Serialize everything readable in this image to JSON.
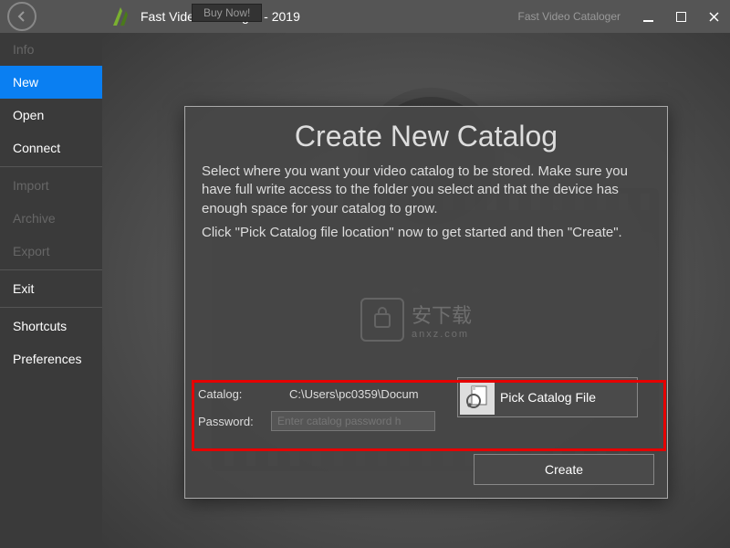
{
  "titlebar": {
    "app_title": "Fast Video Cataloger - 2019",
    "buy_now": "Buy Now!",
    "right_text": "Fast Video Cataloger"
  },
  "sidebar": {
    "items": [
      {
        "label": "Info",
        "active": false,
        "disabled": true
      },
      {
        "label": "New",
        "active": true,
        "disabled": false
      },
      {
        "label": "Open",
        "active": false,
        "disabled": false
      },
      {
        "label": "Connect",
        "active": false,
        "disabled": false
      }
    ],
    "items2": [
      {
        "label": "Import",
        "disabled": true
      },
      {
        "label": "Archive",
        "disabled": true
      },
      {
        "label": "Export",
        "disabled": true
      }
    ],
    "items3": [
      {
        "label": "Exit"
      }
    ],
    "items4": [
      {
        "label": "Shortcuts"
      },
      {
        "label": "Preferences"
      }
    ]
  },
  "dialog": {
    "title": "Create New Catalog",
    "para1": "Select where you want your video catalog to be stored. Make sure you have full write access to the folder you select and that the device has enough space for your catalog to grow.",
    "para2": "Click \"Pick Catalog file location\" now to get started and then \"Create\".",
    "catalog_label": "Catalog:",
    "catalog_value": "C:\\Users\\pc0359\\Docum",
    "password_label": "Password:",
    "password_placeholder": "Enter catalog password h",
    "pick_button": "Pick Catalog File",
    "create_button": "Create"
  },
  "watermark": {
    "text_main": "安下载",
    "text_sub": "anxz.com"
  }
}
